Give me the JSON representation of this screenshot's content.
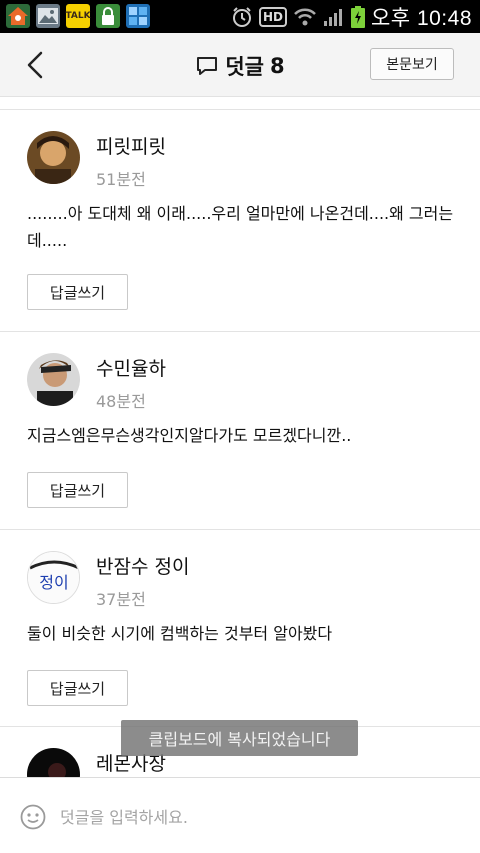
{
  "status_bar": {
    "time": "오후 10:48",
    "hd_label": "HD",
    "talk_label": "TALK"
  },
  "header": {
    "title": "덧글",
    "count": "8",
    "article_button": "본문보기"
  },
  "comments": [
    {
      "name": "피릿피릿",
      "time": "51분전",
      "text": "........아 도대체 왜 이래.....우리 얼마만에 나온건데....왜 그러는데.....",
      "reply_label": "답글쓰기"
    },
    {
      "name": "수민율하",
      "time": "48분전",
      "text": "지금스엠은무슨생각인지알다가도 모르겠다니깐..",
      "reply_label": "답글쓰기"
    },
    {
      "name": "반잠수 정이",
      "time": "37분전",
      "text": "둘이 비슷한 시기에 컴백하는 것부터 알아봤다",
      "reply_label": "답글쓰기",
      "avatar_text": "정이"
    },
    {
      "name": "레몬사장"
    }
  ],
  "toast": "클립보드에 복사되었습니다",
  "input": {
    "placeholder": "덧글을 입력하세요."
  }
}
